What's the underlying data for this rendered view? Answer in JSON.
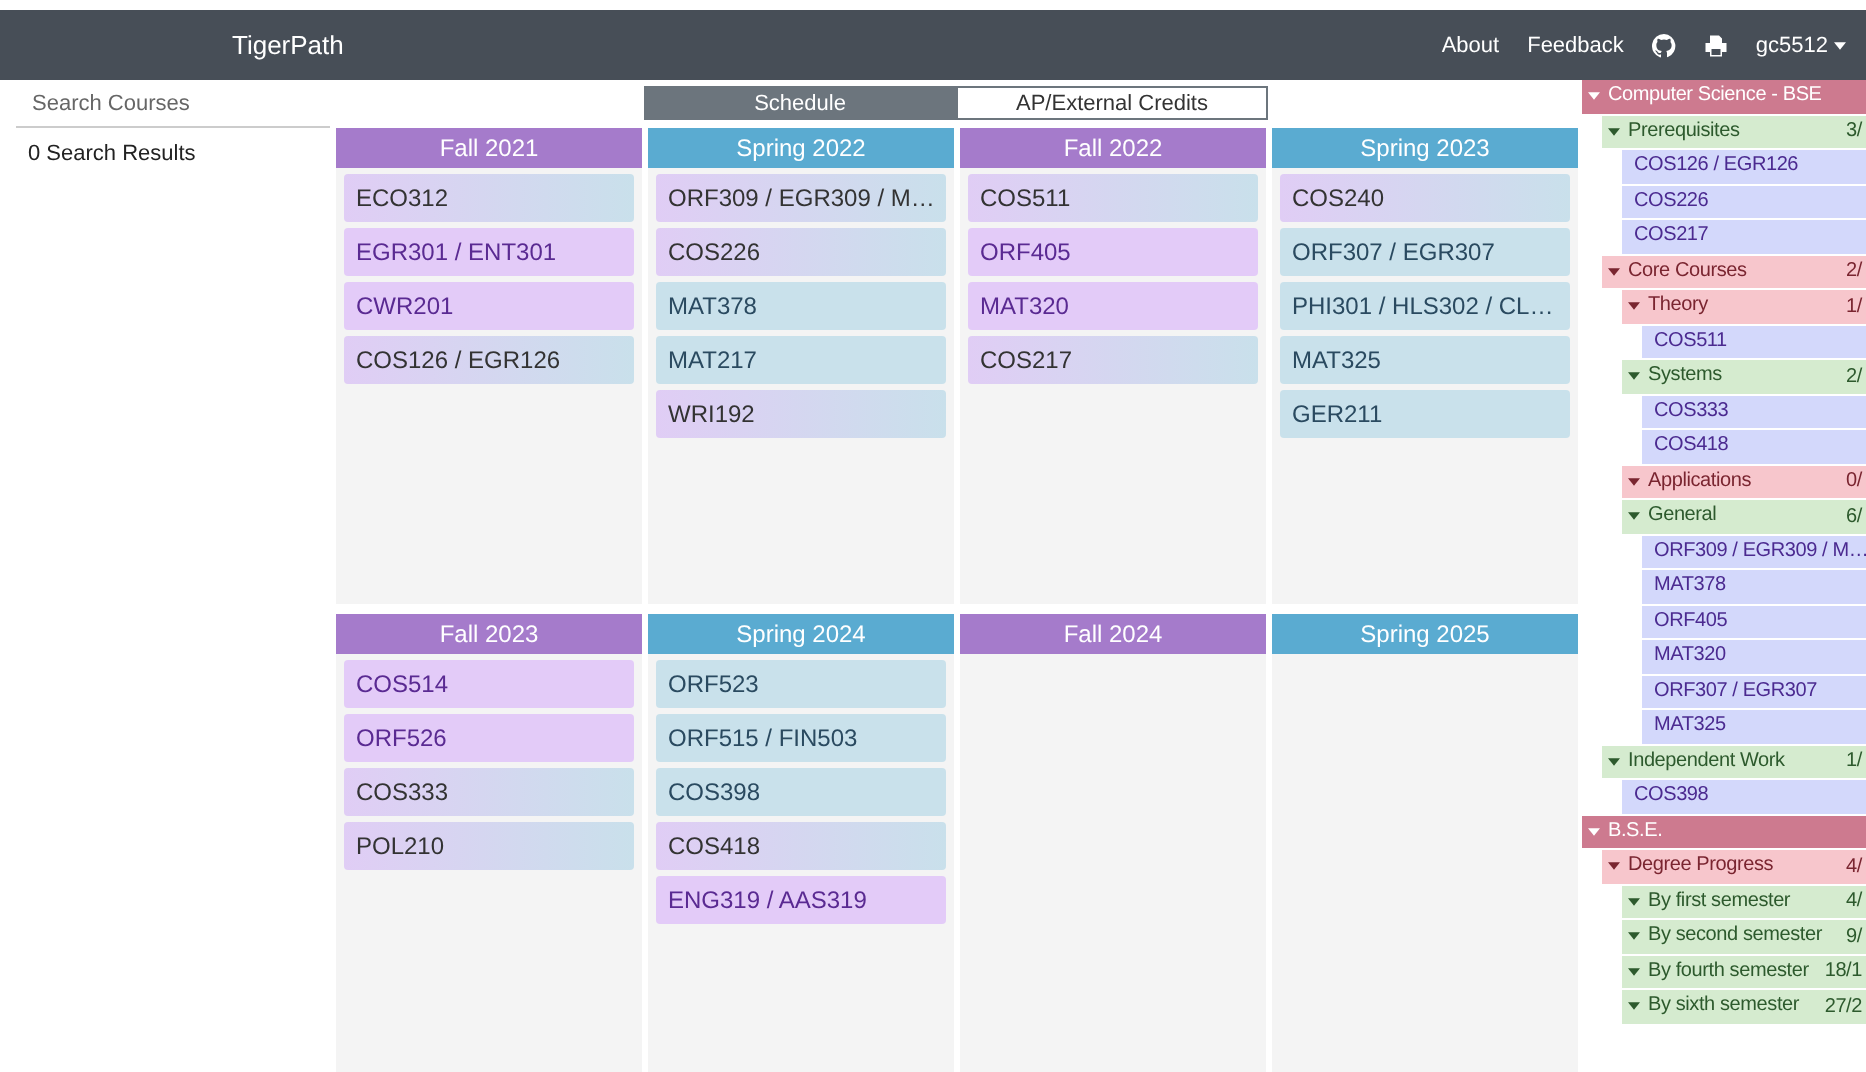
{
  "navbar": {
    "brand": "TigerPath",
    "links": [
      "About",
      "Feedback"
    ],
    "user": "gc5512"
  },
  "search": {
    "placeholder": "Search Courses",
    "results": "0 Search Results"
  },
  "view_tabs": [
    {
      "label": "Schedule",
      "selected": true
    },
    {
      "label": "AP/External Credits",
      "selected": false
    }
  ],
  "semesters": [
    {
      "title": "Fall 2021",
      "kind": "fall",
      "courses": [
        {
          "code": "ECO312",
          "kind": "both"
        },
        {
          "code": "EGR301 / ENT301",
          "kind": "fall"
        },
        {
          "code": "CWR201",
          "kind": "fall"
        },
        {
          "code": "COS126 / EGR126",
          "kind": "both"
        }
      ]
    },
    {
      "title": "Spring 2022",
      "kind": "spring",
      "courses": [
        {
          "code": "ORF309 / EGR309 / M…",
          "kind": "both"
        },
        {
          "code": "COS226",
          "kind": "both"
        },
        {
          "code": "MAT378",
          "kind": "spring"
        },
        {
          "code": "MAT217",
          "kind": "spring"
        },
        {
          "code": "WRI192",
          "kind": "both"
        }
      ]
    },
    {
      "title": "Fall 2022",
      "kind": "fall",
      "courses": [
        {
          "code": "COS511",
          "kind": "both"
        },
        {
          "code": "ORF405",
          "kind": "fall"
        },
        {
          "code": "MAT320",
          "kind": "fall"
        },
        {
          "code": "COS217",
          "kind": "both"
        }
      ]
    },
    {
      "title": "Spring 2023",
      "kind": "spring",
      "courses": [
        {
          "code": "COS240",
          "kind": "both"
        },
        {
          "code": "ORF307 / EGR307",
          "kind": "spring"
        },
        {
          "code": "PHI301 / HLS302 / CL…",
          "kind": "spring"
        },
        {
          "code": "MAT325",
          "kind": "spring"
        },
        {
          "code": "GER211",
          "kind": "spring"
        }
      ]
    },
    {
      "title": "Fall 2023",
      "kind": "fall",
      "courses": [
        {
          "code": "COS514",
          "kind": "fall"
        },
        {
          "code": "ORF526",
          "kind": "fall"
        },
        {
          "code": "COS333",
          "kind": "both"
        },
        {
          "code": "POL210",
          "kind": "both"
        }
      ]
    },
    {
      "title": "Spring 2024",
      "kind": "spring",
      "courses": [
        {
          "code": "ORF523",
          "kind": "spring"
        },
        {
          "code": "ORF515 / FIN503",
          "kind": "spring"
        },
        {
          "code": "COS398",
          "kind": "spring"
        },
        {
          "code": "COS418",
          "kind": "both"
        },
        {
          "code": "ENG319 / AAS319",
          "kind": "fall"
        }
      ]
    },
    {
      "title": "Fall 2024",
      "kind": "fall"
    },
    {
      "title": "Spring 2025",
      "kind": "spring"
    }
  ],
  "requirements": [
    {
      "kind": "program",
      "label": "Computer Science - BSE",
      "expanded": true,
      "children": [
        {
          "kind": "group",
          "label": "Prerequisites",
          "count": "3/",
          "satisfied": true,
          "expanded": true,
          "children": [
            {
              "kind": "course",
              "label": "COS126 / EGR126"
            },
            {
              "kind": "course",
              "label": "COS226"
            },
            {
              "kind": "course",
              "label": "COS217"
            }
          ]
        },
        {
          "kind": "group",
          "label": "Core Courses",
          "count": "2/",
          "satisfied": false,
          "expanded": true,
          "children": [
            {
              "kind": "group",
              "label": "Theory",
              "count": "1/",
              "satisfied": false,
              "expanded": true,
              "children": [
                {
                  "kind": "course",
                  "label": "COS511"
                }
              ]
            },
            {
              "kind": "group",
              "label": "Systems",
              "count": "2/",
              "satisfied": true,
              "expanded": true,
              "children": [
                {
                  "kind": "course",
                  "label": "COS333"
                },
                {
                  "kind": "course",
                  "label": "COS418"
                }
              ]
            },
            {
              "kind": "group",
              "label": "Applications",
              "count": "0/",
              "satisfied": false,
              "expanded": true
            },
            {
              "kind": "group",
              "label": "General",
              "count": "6/",
              "satisfied": true,
              "expanded": true,
              "children": [
                {
                  "kind": "course",
                  "label": "ORF309 / EGR309 / M…"
                },
                {
                  "kind": "course",
                  "label": "MAT378"
                },
                {
                  "kind": "course",
                  "label": "ORF405"
                },
                {
                  "kind": "course",
                  "label": "MAT320"
                },
                {
                  "kind": "course",
                  "label": "ORF307 / EGR307"
                },
                {
                  "kind": "course",
                  "label": "MAT325"
                }
              ]
            }
          ]
        },
        {
          "kind": "group",
          "label": "Independent Work",
          "count": "1/",
          "satisfied": true,
          "expanded": true,
          "children": [
            {
              "kind": "course",
              "label": "COS398"
            }
          ]
        }
      ]
    },
    {
      "kind": "program",
      "label": "B.S.E.",
      "expanded": true,
      "children": [
        {
          "kind": "group",
          "label": "Degree Progress",
          "count": "4/",
          "satisfied": false,
          "expanded": true,
          "children": [
            {
              "kind": "group",
              "label": "By first semester",
              "count": "4/",
              "satisfied": true,
              "expanded": true
            },
            {
              "kind": "group",
              "label": "By second semester",
              "count": "9/",
              "satisfied": true,
              "expanded": true
            },
            {
              "kind": "group",
              "label": "By fourth semester",
              "count": "18/1",
              "satisfied": true,
              "expanded": true
            },
            {
              "kind": "group",
              "label": "By sixth semester",
              "count": "27/2",
              "satisfied": true,
              "expanded": true
            }
          ]
        }
      ]
    }
  ]
}
